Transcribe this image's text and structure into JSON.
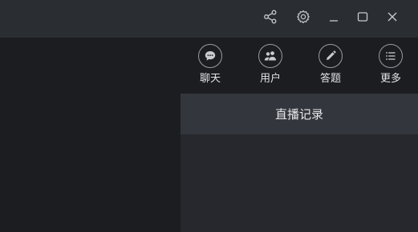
{
  "titlebar": {
    "icons": [
      "share-icon",
      "gear-icon",
      "minimize-icon",
      "maximize-icon",
      "close-icon"
    ]
  },
  "toolbar": {
    "items": [
      {
        "icon": "chat-bubble-icon",
        "label": "聊天"
      },
      {
        "icon": "users-icon",
        "label": "用户"
      },
      {
        "icon": "pencil-icon",
        "label": "答题"
      },
      {
        "icon": "list-icon",
        "label": "更多"
      }
    ]
  },
  "panel": {
    "header": "直播记录"
  },
  "colors": {
    "titlebar_bg": "#2a2d31",
    "body_bg": "#1b1d21",
    "panel_bg": "#26282d",
    "panel_header_bg": "#34363d",
    "text": "#e2e3e5"
  }
}
